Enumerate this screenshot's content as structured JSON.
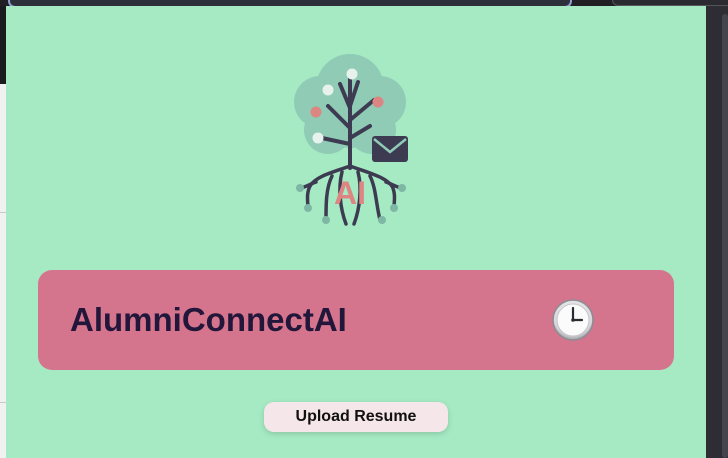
{
  "app": {
    "title": "AlumniConnectAI",
    "logo_text": "AI",
    "logo_icon": "tree-mail-icon"
  },
  "header": {
    "history_icon": "clock-icon"
  },
  "actions": {
    "upload_label": "Upload Resume"
  },
  "colors": {
    "panel_bg": "#a5eac3",
    "card_bg": "#d4758d",
    "title_color": "#22163a",
    "button_bg": "#f5e6ea"
  }
}
